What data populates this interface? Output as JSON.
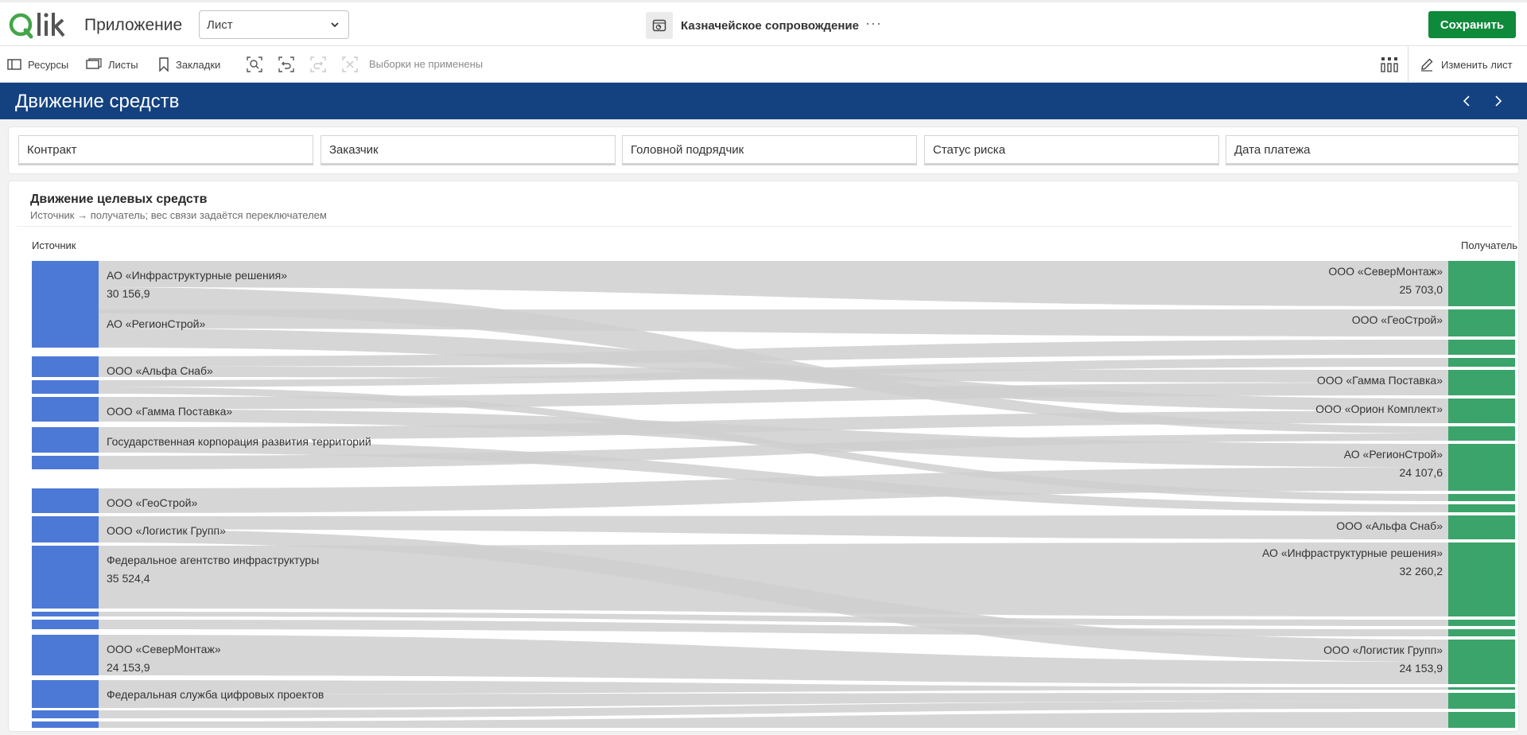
{
  "header": {
    "logo_text": "Qlik",
    "app_label": "Приложение",
    "sheet_select_value": "Лист",
    "app_name": "Казначейское сопровождение",
    "more": "···",
    "save_label": "Сохранить"
  },
  "toolbar": {
    "resources": "Ресурсы",
    "sheets": "Листы",
    "bookmarks": "Закладки",
    "no_selections": "Выборки не применены",
    "edit_sheet": "Изменить лист"
  },
  "sheet": {
    "title": "Движение средств"
  },
  "filters": [
    "Контракт",
    "Заказчик",
    "Головной подрядчик",
    "Статус риска",
    "Дата платежа"
  ],
  "chart": {
    "title": "Движение целевых средств",
    "subtitle": "Источник → получатель; вес связи задаётся переключателем",
    "source_header": "Источник",
    "target_header": "Получатель"
  },
  "colors": {
    "brand_blue": "#144280",
    "save_green": "#0f8a3a",
    "source_node": "#4d79d6",
    "target_node": "#3aa46a",
    "link": "#cfcfcf"
  },
  "chart_data": {
    "type": "sankey",
    "sources": [
      {
        "name": "АО «Инфраструктурные решения»",
        "value": "30 156,9"
      },
      {
        "name": "АО «РегионСтрой»",
        "value": ""
      },
      {
        "name": "ООО «Альфа Снаб»",
        "value": ""
      },
      {
        "name": "",
        "value": ""
      },
      {
        "name": "ООО «Гамма Поставка»",
        "value": ""
      },
      {
        "name": "Государственная корпорация развития территорий",
        "value": ""
      },
      {
        "name": "",
        "value": ""
      },
      {
        "name": "ООО «ГеоСтрой»",
        "value": ""
      },
      {
        "name": "ООО «Логистик Групп»",
        "value": ""
      },
      {
        "name": "Федеральное агентство инфраструктуры",
        "value": "35 524,4"
      },
      {
        "name": "",
        "value": ""
      },
      {
        "name": "",
        "value": ""
      },
      {
        "name": "ООО «СеверМонтаж»",
        "value": "24 153,9"
      },
      {
        "name": "Федеральная служба цифровых проектов",
        "value": ""
      },
      {
        "name": "",
        "value": ""
      },
      {
        "name": "",
        "value": ""
      }
    ],
    "targets": [
      {
        "name": "ООО «СеверМонтаж»",
        "value": "25 703,0"
      },
      {
        "name": "ООО «ГеоСтрой»",
        "value": ""
      },
      {
        "name": "",
        "value": ""
      },
      {
        "name": "",
        "value": ""
      },
      {
        "name": "ООО «Гамма Поставка»",
        "value": ""
      },
      {
        "name": "ООО «Орион Комплект»",
        "value": ""
      },
      {
        "name": "",
        "value": ""
      },
      {
        "name": "АО «РегионСтрой»",
        "value": "24 107,6"
      },
      {
        "name": "",
        "value": ""
      },
      {
        "name": "",
        "value": ""
      },
      {
        "name": "ООО «Альфа Снаб»",
        "value": ""
      },
      {
        "name": "АО «Инфраструктурные решения»",
        "value": "32 260,2"
      },
      {
        "name": "",
        "value": ""
      },
      {
        "name": "",
        "value": ""
      },
      {
        "name": "ООО «Логистик Групп»",
        "value": "24 153,9"
      },
      {
        "name": "",
        "value": ""
      },
      {
        "name": "",
        "value": ""
      },
      {
        "name": "",
        "value": ""
      }
    ]
  }
}
